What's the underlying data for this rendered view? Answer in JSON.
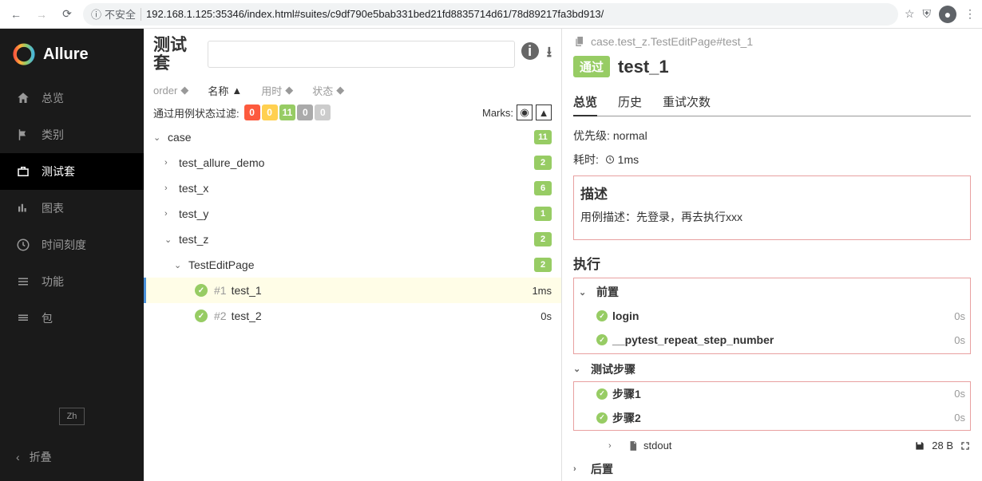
{
  "browser": {
    "insecure_label": "不安全",
    "url": "192.168.1.125:35346/index.html#suites/c9df790e5bab331bed21fd8835714d61/78d89217fa3bd913/"
  },
  "sidebar": {
    "brand": "Allure",
    "items": [
      {
        "label": "总览"
      },
      {
        "label": "类别"
      },
      {
        "label": "测试套"
      },
      {
        "label": "图表"
      },
      {
        "label": "时间刻度"
      },
      {
        "label": "功能"
      },
      {
        "label": "包"
      }
    ],
    "lang": "Zh",
    "collapse": "折叠"
  },
  "tree": {
    "title": "测试套",
    "sort": {
      "order": "order",
      "name": "名称",
      "duration": "用时",
      "status": "状态"
    },
    "filter_label": "通过用例状态过滤:",
    "badges": [
      "0",
      "0",
      "11",
      "0",
      "0"
    ],
    "marks_label": "Marks:",
    "nodes": {
      "root": "case",
      "root_count": "11",
      "n1": "test_allure_demo",
      "n1_count": "2",
      "n2": "test_x",
      "n2_count": "6",
      "n3": "test_y",
      "n3_count": "1",
      "n4": "test_z",
      "n4_count": "2",
      "n5": "TestEditPage",
      "n5_count": "2",
      "leaf1_num": "#1",
      "leaf1_name": "test_1",
      "leaf1_dur": "1ms",
      "leaf2_num": "#2",
      "leaf2_name": "test_2",
      "leaf2_dur": "0s"
    }
  },
  "detail": {
    "crumb": "case.test_z.TestEditPage#test_1",
    "status": "通过",
    "title": "test_1",
    "tabs": {
      "overview": "总览",
      "history": "历史",
      "retries": "重试次数"
    },
    "priority_label": "优先级:",
    "priority_value": "normal",
    "duration_label": "耗时:",
    "duration_value": "1ms",
    "desc_heading": "描述",
    "desc_text": "用例描述：先登录，再去执行xxx",
    "exec_heading": "执行",
    "setup_heading": "前置",
    "setup_steps": [
      {
        "name": "login",
        "dur": "0s"
      },
      {
        "name": "__pytest_repeat_step_number",
        "dur": "0s"
      }
    ],
    "body_heading": "测试步骤",
    "body_steps": [
      {
        "name": "步骤1",
        "dur": "0s"
      },
      {
        "name": "步骤2",
        "dur": "0s"
      }
    ],
    "stdout_label": "stdout",
    "stdout_size": "28 B",
    "teardown_heading": "后置"
  }
}
